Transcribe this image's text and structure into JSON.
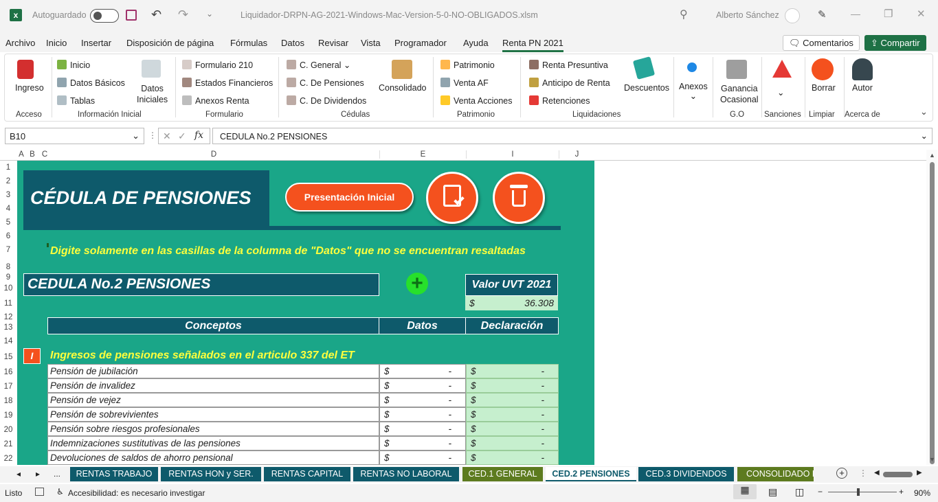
{
  "titlebar": {
    "autosave_label": "Autoguardado",
    "file_name": "Liquidador-DRPN-AG-2021-Windows-Mac-Version-5-0-NO-OBLIGADOS.xlsm",
    "user_name": "Alberto Sánchez"
  },
  "menu": {
    "items": [
      "Archivo",
      "Inicio",
      "Insertar",
      "Disposición de página",
      "Fórmulas",
      "Datos",
      "Revisar",
      "Vista",
      "Programador",
      "Ayuda",
      "Renta PN 2021"
    ],
    "active": "Renta PN 2021",
    "comments_label": "Comentarios",
    "share_label": "Compartir"
  },
  "ribbon": {
    "ingreso": "Ingreso",
    "inicio": "Inicio",
    "datos_basicos": "Datos Básicos",
    "tablas": "Tablas",
    "datos_iniciales_1": "Datos",
    "datos_iniciales_2": "Iniciales",
    "formulario_210": "Formulario 210",
    "estados_financieros": "Estados Financieros",
    "anexos_renta": "Anexos Renta",
    "c_general": "C. General",
    "c_pensiones": "C. De Pensiones",
    "c_dividendos": "C. De Dividendos",
    "consolidado": "Consolidado",
    "patrimonio": "Patrimonio",
    "venta_af": "Venta AF",
    "venta_acciones": "Venta Acciones",
    "renta_presuntiva": "Renta Presuntiva",
    "anticipo": "Anticipo de Renta",
    "retenciones": "Retenciones",
    "descuentos": "Descuentos",
    "anexos": "Anexos",
    "ganancia_1": "Ganancia",
    "ganancia_2": "Ocasional",
    "borrar": "Borrar",
    "autor": "Autor",
    "groups": {
      "acceso": "Acceso",
      "informacion": "Información Inicial",
      "formulario": "Formulario",
      "cedulas": "Cédulas",
      "patrimonio": "Patrimonio",
      "liquidaciones": "Liquidaciones",
      "go": "G.O",
      "sanciones": "Sanciones",
      "limpiar": "Limpiar",
      "acerca": "Acerca de"
    }
  },
  "formula_bar": {
    "name_box": "B10",
    "fx": "fx",
    "content": "CEDULA No.2 PENSIONES"
  },
  "columns": [
    "A",
    "B",
    "C",
    "D",
    "E",
    "I",
    "J"
  ],
  "rows": [
    "1",
    "2",
    "3",
    "4",
    "5",
    "6",
    "7",
    "8",
    "9",
    "10",
    "11",
    "12",
    "13",
    "14",
    "15",
    "16",
    "17",
    "18",
    "19",
    "20",
    "21",
    "22"
  ],
  "sheet": {
    "banner_title": "CÉDULA DE PENSIONES",
    "btn_presentacion": "Presentación Inicial",
    "instruction": "Digite solamente en las casillas de la columna de \"Datos\" que no se encuentran resaltadas",
    "cedula_title": "CEDULA No.2 PENSIONES",
    "uvt_label": "Valor UVT 2021",
    "uvt_currency": "$",
    "uvt_value": "36.308",
    "headers": {
      "conceptos": "Conceptos",
      "datos": "Datos",
      "declaracion": "Declaración"
    },
    "section_num": "I",
    "section_title": "Ingresos de pensiones señalados en el articulo 337 del ET",
    "currency": "$",
    "empty_value": "-",
    "items": [
      "Pensión de jubilación",
      "Pensión de invalidez",
      "Pensión de vejez",
      "Pensión de sobrevivientes",
      "Pensión sobre riesgos profesionales",
      "Indemnizaciones sustitutivas de las pensiones",
      "Devoluciones de saldos de ahorro pensional"
    ]
  },
  "tabs": [
    {
      "label": "...",
      "color": "#f3f3f3"
    },
    {
      "label": "RENTAS TRABAJO",
      "color": "#0e5a6b"
    },
    {
      "label": "RENTAS HON y SER.",
      "color": "#0e5a6b"
    },
    {
      "label": "RENTAS CAPITAL",
      "color": "#0e5a6b"
    },
    {
      "label": "RENTAS NO LABORAL",
      "color": "#0e5a6b"
    },
    {
      "label": "CED.1 GENERAL",
      "color": "#5d7b1f"
    },
    {
      "label": "CED.2 PENSIONES",
      "color": "#ffffff"
    },
    {
      "label": "CED.3 DIVIDENDOS",
      "color": "#0e5a6b"
    },
    {
      "label": "CONSOLIDADO RENTAS",
      "color": "#5d7b1f"
    }
  ],
  "status": {
    "ready": "Listo",
    "accessibility": "Accesibilidad: es necesario investigar",
    "zoom": "90%",
    "zoom_minus": "−",
    "zoom_plus": "+"
  }
}
